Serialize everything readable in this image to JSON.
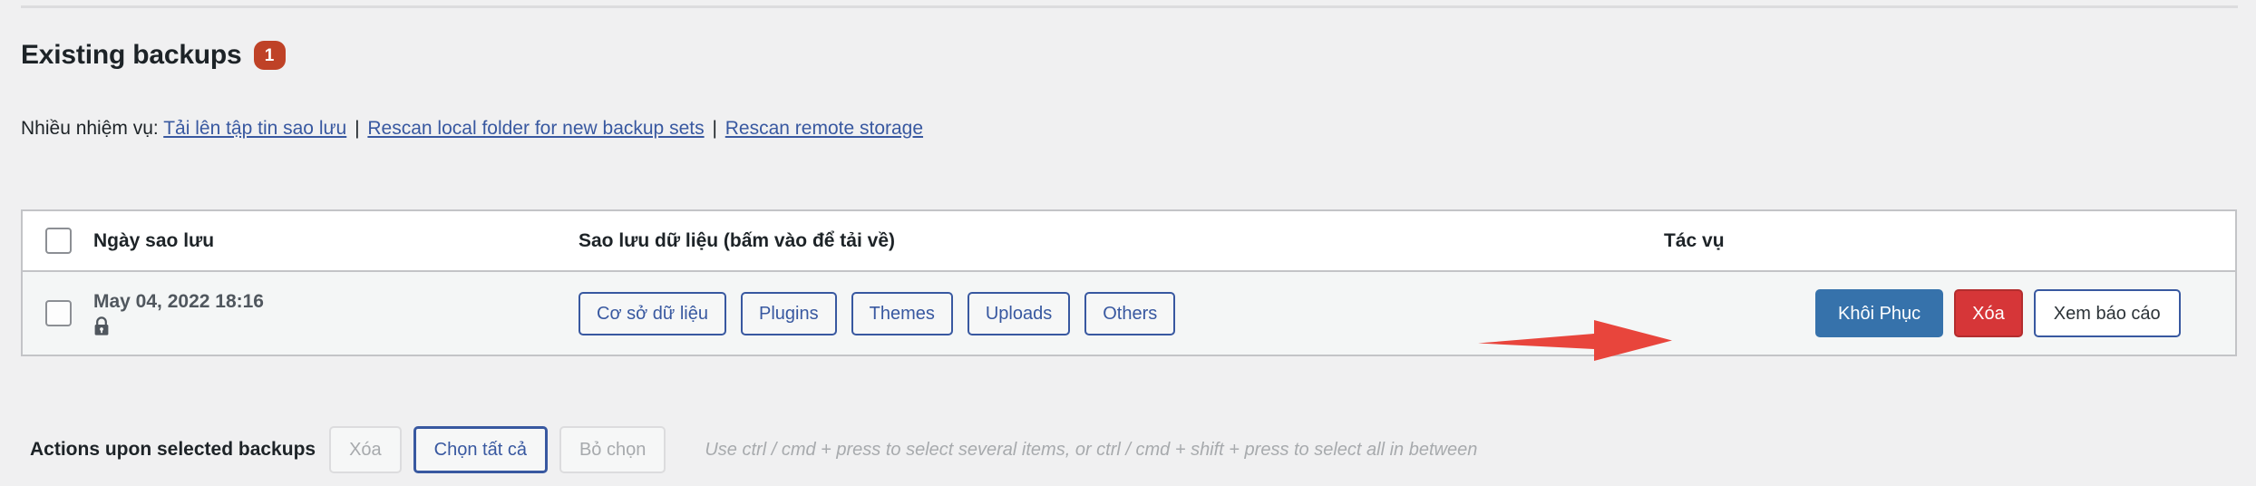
{
  "page": {
    "title": "Existing backups",
    "badge_count": "1",
    "badge_color": "#bf4227"
  },
  "tasks": {
    "label": "Nhiều nhiệm vụ:",
    "separator": "|",
    "links": [
      {
        "label": "Tải lên tập tin sao lưu"
      },
      {
        "label": "Rescan local folder for new backup sets"
      },
      {
        "label": "Rescan remote storage"
      }
    ],
    "link_color": "#3858a0"
  },
  "table": {
    "headers": {
      "select_all": "",
      "date": "Ngày sao lưu",
      "data": "Sao lưu dữ liệu (bấm vào để tải về)",
      "actions": "Tác vụ"
    },
    "rows": [
      {
        "selected": false,
        "date": "May 04, 2022 18:16",
        "lock_icon": "lock-icon",
        "entities": [
          {
            "label": "Cơ sở dữ liệu"
          },
          {
            "label": "Plugins"
          },
          {
            "label": "Themes"
          },
          {
            "label": "Uploads"
          },
          {
            "label": "Others"
          }
        ],
        "actions": [
          {
            "label": "Khôi Phục",
            "style": "primary",
            "color": "#3672ab"
          },
          {
            "label": "Xóa",
            "style": "danger",
            "color": "#d63638"
          },
          {
            "label": "Xem báo cáo",
            "style": "outline"
          }
        ]
      }
    ]
  },
  "annotation": {
    "arrow": "right-arrow-annotation",
    "color": "#e8453c",
    "points_to": "Khôi Phục"
  },
  "footer": {
    "label": "Actions upon selected backups",
    "buttons": [
      {
        "label": "Xóa",
        "state": "disabled"
      },
      {
        "label": "Chọn tất cả",
        "state": "selected"
      },
      {
        "label": "Bỏ chọn",
        "state": "disabled"
      }
    ],
    "hint": "Use ctrl / cmd + press to select several items, or ctrl / cmd + shift + press to select all in between"
  }
}
